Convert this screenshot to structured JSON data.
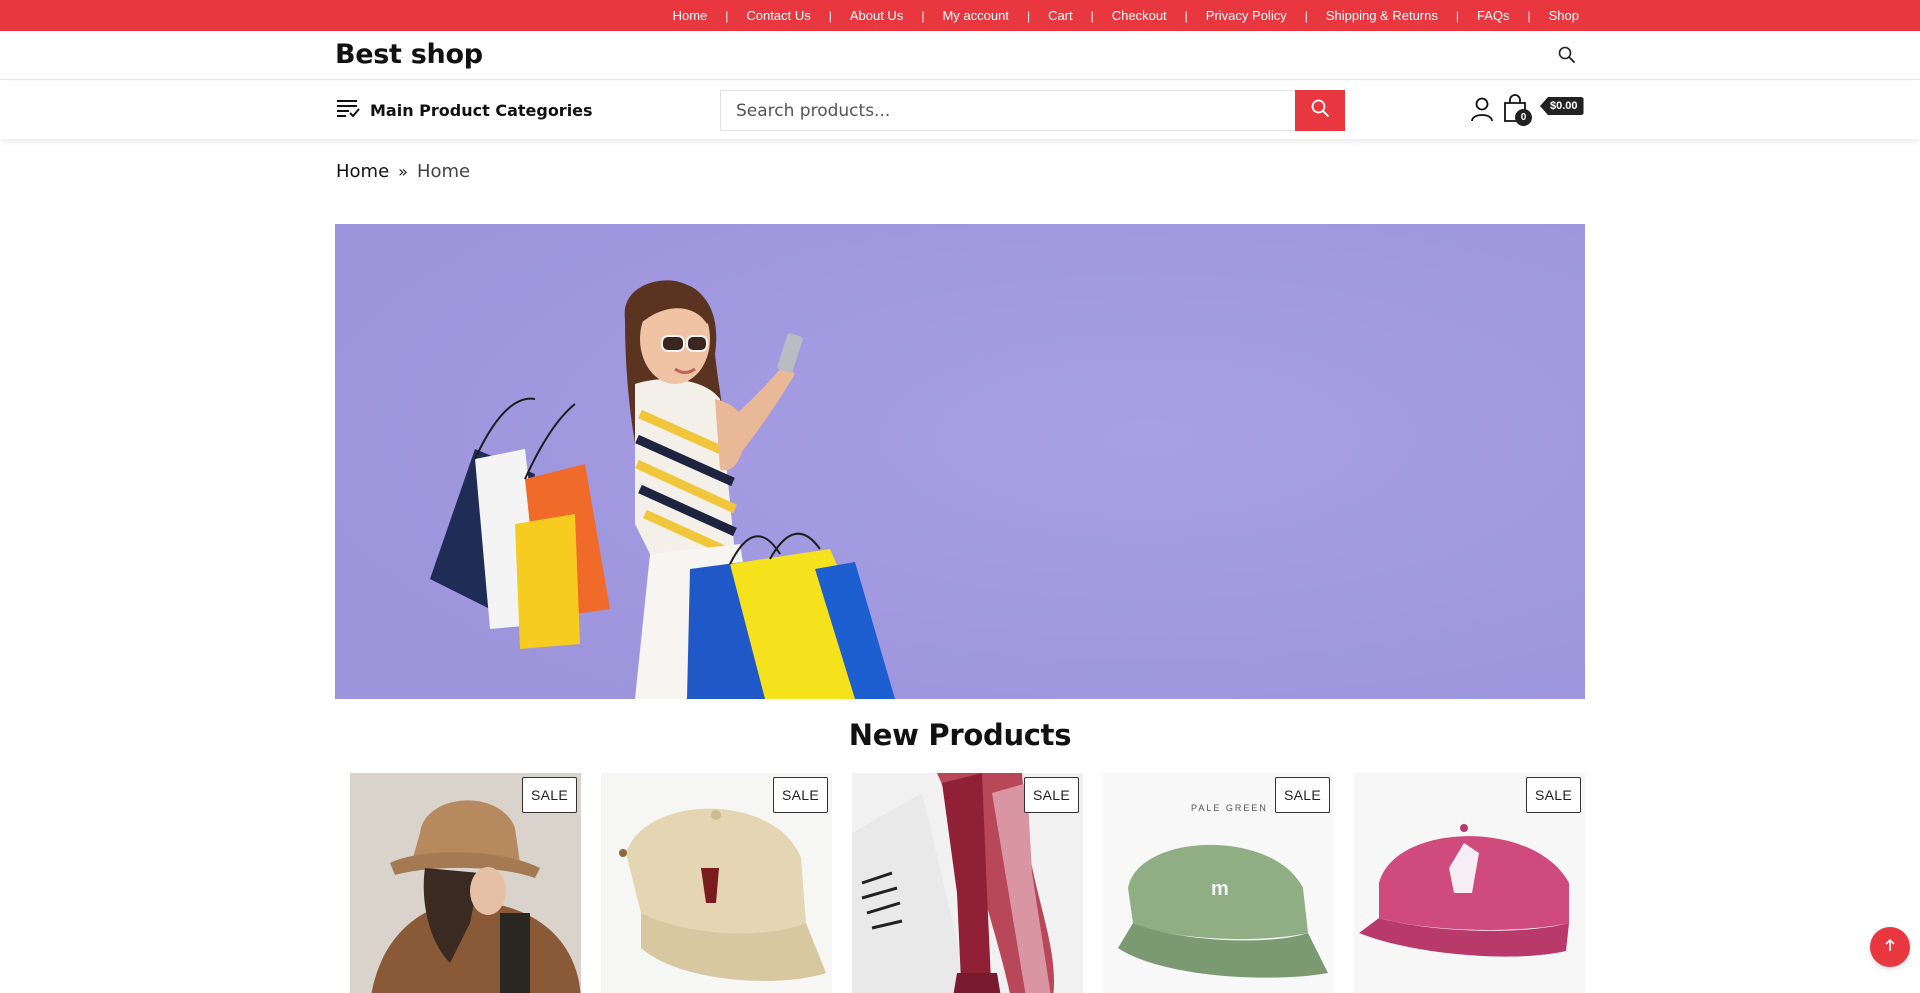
{
  "top_nav": {
    "items": [
      {
        "label": "Home"
      },
      {
        "label": "Contact Us"
      },
      {
        "label": "About Us"
      },
      {
        "label": "My account"
      },
      {
        "label": "Cart"
      },
      {
        "label": "Checkout"
      },
      {
        "label": "Privacy Policy"
      },
      {
        "label": "Shipping & Returns"
      },
      {
        "label": "FAQs"
      },
      {
        "label": "Shop"
      }
    ],
    "separator": "|"
  },
  "header": {
    "site_title": "Best shop",
    "search_icon": "search-icon"
  },
  "navbar": {
    "categories_label": "Main Product Categories",
    "categories_icon": "menu-list-icon",
    "search_placeholder": "Search products...",
    "search_button_icon": "search-icon",
    "account_icon": "user-icon",
    "cart_icon": "shopping-bag-icon",
    "cart_count": "0",
    "cart_total": "$0.00"
  },
  "breadcrumb": {
    "items": [
      "Home",
      "Home"
    ],
    "separator": "»"
  },
  "hero": {
    "image": "woman-with-shopping-bags-banner"
  },
  "new_products": {
    "title": "New Products",
    "items": [
      {
        "image": "beige-bucket-hat",
        "badge": "SALE"
      },
      {
        "image": "cream-baseball-cap",
        "badge": "SALE"
      },
      {
        "image": "red-striped-scarf",
        "badge": "SALE"
      },
      {
        "image": "pale-green-cap",
        "badge": "SALE",
        "image_text": "PALE GREEN"
      },
      {
        "image": "pink-baseball-cap",
        "badge": "SALE"
      }
    ]
  },
  "scroll_top_icon": "arrow-up-icon",
  "colors": {
    "accent": "#e8373f",
    "hero_bg": "#a39ae0",
    "dark": "#222222"
  }
}
